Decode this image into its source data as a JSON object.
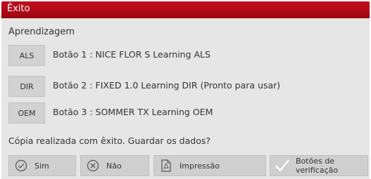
{
  "window": {
    "title": "Êxito"
  },
  "section": {
    "label": "Aprendizagem"
  },
  "rows": [
    {
      "key": "ALS",
      "label": "Botão 1 : NICE FLOR S Learning ALS"
    },
    {
      "key": "DIR",
      "label": "Botão 2 : FIXED 1.0 Learning DIR (Pronto para usar)"
    },
    {
      "key": "OEM",
      "label": "Botão 3 : SOMMER TX Learning OEM"
    }
  ],
  "question": "Cópia realizada com êxito. Guardar os dados?",
  "buttons": {
    "yes": {
      "label": "Sim",
      "icon": "check-circle-icon"
    },
    "no": {
      "label": "Não",
      "icon": "x-circle-icon"
    },
    "print": {
      "label": "Impressão",
      "icon": "pdf-document-icon"
    },
    "verify": {
      "label": "Botões de verificação",
      "icon": "checkmark-icon"
    }
  },
  "colors": {
    "titlebar": "#b00917",
    "background": "#e6e6e6",
    "button": "#cfcfcf"
  }
}
